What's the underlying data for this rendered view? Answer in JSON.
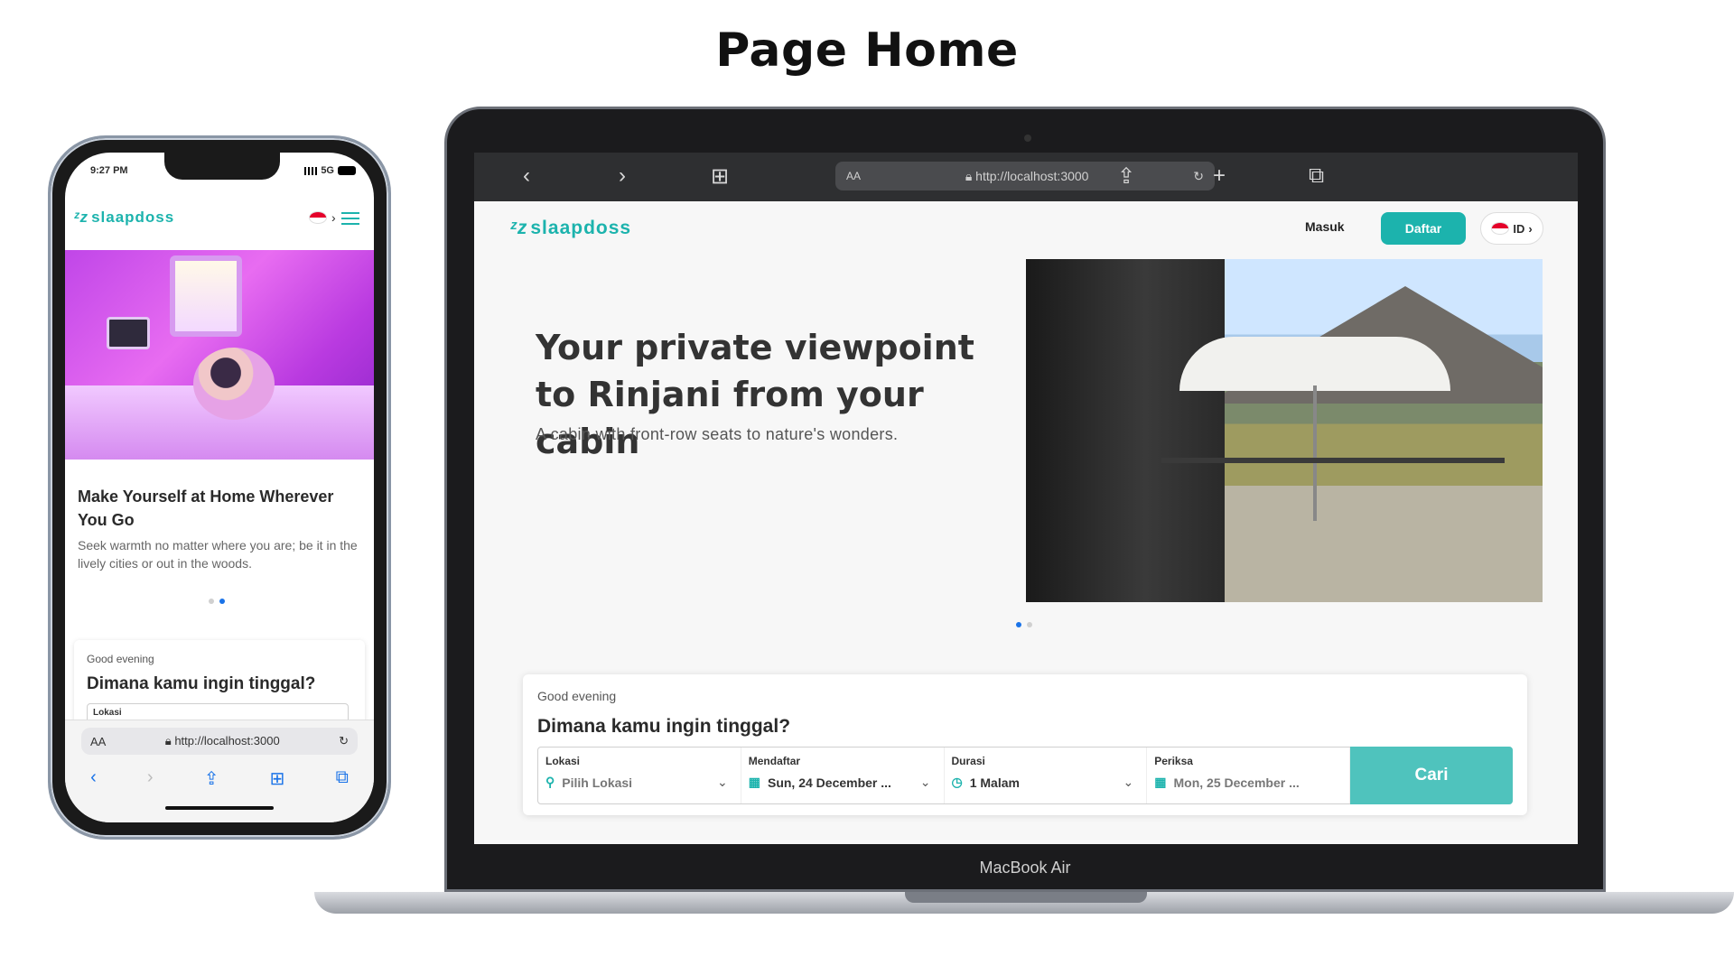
{
  "page_title": "Page Home",
  "phone": {
    "status_time": "9:27 PM",
    "network": "5G",
    "logo_text": "slaapdoss",
    "card_title": "Make Yourself at Home Wherever You Go",
    "card_desc": "Seek warmth no matter where you are; be it in the lively cities or out in the woods.",
    "greeting": "Good evening",
    "question": "Dimana kamu ingin tinggal?",
    "location_label": "Lokasi",
    "url": "http://localhost:3000",
    "aa": "AA"
  },
  "laptop": {
    "url": "http://localhost:3000",
    "aa": "AA",
    "logo_text": "slaapdoss",
    "login_label": "Masuk",
    "register_label": "Daftar",
    "language": "ID",
    "hero_title": "Your private viewpoint to Rinjani from your cabin",
    "hero_subtitle": "A cabin with front-row seats to nature's wonders.",
    "greeting": "Good evening",
    "question": "Dimana kamu ingin tinggal?",
    "fields": {
      "location": {
        "label": "Lokasi",
        "value": "Pilih Lokasi"
      },
      "checkin": {
        "label": "Mendaftar",
        "value": "Sun, 24 December ..."
      },
      "duration": {
        "label": "Durasi",
        "value": "1 Malam"
      },
      "checkout": {
        "label": "Periksa",
        "value": "Mon, 25 December ..."
      }
    },
    "search_button": "Cari",
    "device_label": "MacBook Air"
  },
  "colors": {
    "accent": "#1cb3ad",
    "button": "#4fc3bd"
  }
}
